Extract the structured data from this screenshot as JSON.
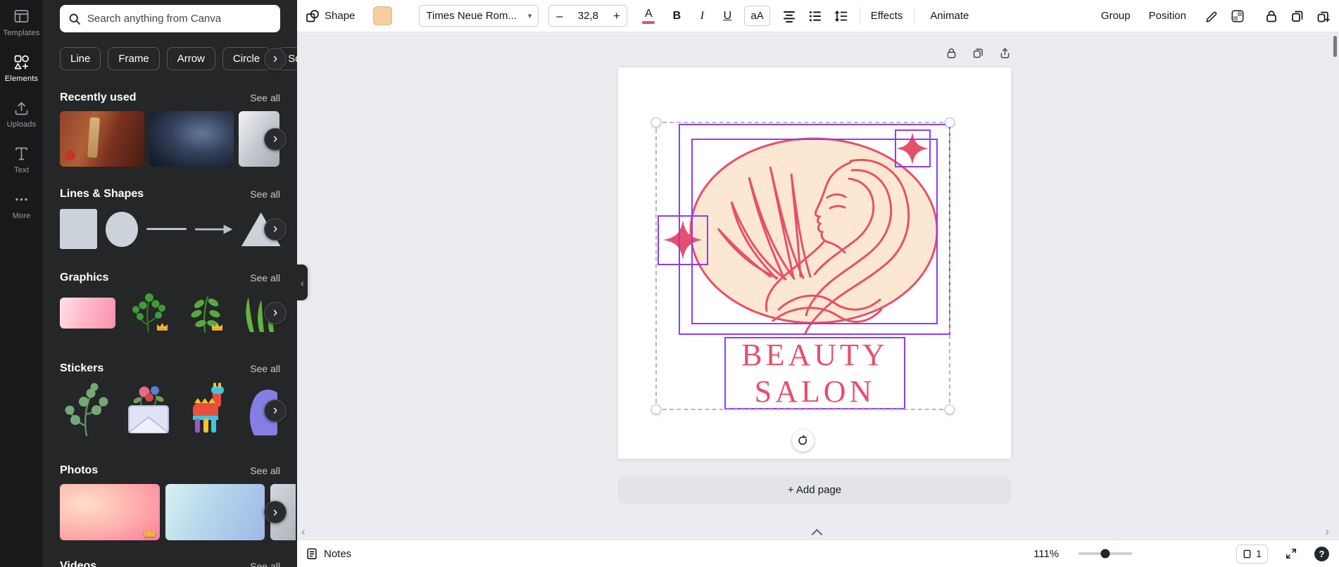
{
  "colors": {
    "purple": "#8b3dff",
    "pink": "#e6506b",
    "peach": "#fce8d2",
    "fill_swatch": "#f5cf9e"
  },
  "rail": {
    "items": [
      {
        "label": "Templates"
      },
      {
        "label": "Elements"
      },
      {
        "label": "Uploads"
      },
      {
        "label": "Text"
      },
      {
        "label": "More"
      }
    ]
  },
  "panel": {
    "search": {
      "placeholder": "Search anything from Canva"
    },
    "chips": [
      {
        "label": "Line"
      },
      {
        "label": "Frame"
      },
      {
        "label": "Arrow"
      },
      {
        "label": "Circle"
      },
      {
        "label": "Square"
      }
    ],
    "sections": {
      "recently_used": {
        "title": "Recently used",
        "see_all": "See all"
      },
      "lines_shapes": {
        "title": "Lines & Shapes",
        "see_all": "See all"
      },
      "graphics": {
        "title": "Graphics",
        "see_all": "See all"
      },
      "stickers": {
        "title": "Stickers",
        "see_all": "See all"
      },
      "photos": {
        "title": "Photos",
        "see_all": "See all"
      },
      "videos": {
        "title": "Videos",
        "see_all": "See all"
      }
    }
  },
  "toolbar": {
    "shape": "Shape",
    "font_name": "Times Neue Rom...",
    "font_size": "32,8",
    "minus": "–",
    "plus": "+",
    "text_color": "A",
    "bold": "B",
    "italic": "I",
    "underline": "U",
    "case_button": "aA",
    "effects": "Effects",
    "animate": "Animate",
    "group": "Group",
    "position": "Position"
  },
  "canvas": {
    "logo": {
      "line1": "BEAUTY",
      "line2": "SALON"
    },
    "add_page": "+ Add page"
  },
  "statusbar": {
    "notes": "Notes",
    "zoom": "111%",
    "page": "1",
    "help": "?"
  },
  "icons": {
    "chevron_right": "›",
    "chevron_left": "‹",
    "chevron_down": "▾"
  }
}
